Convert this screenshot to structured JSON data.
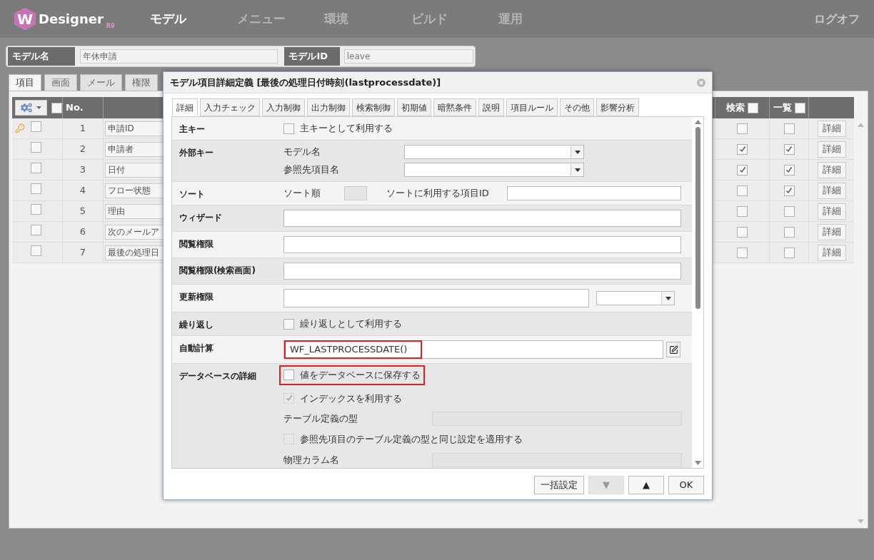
{
  "header": {
    "logo_letter": "W",
    "brand": "Designer",
    "version": "R9",
    "nav": [
      {
        "label": "モデル",
        "selected": true
      },
      {
        "label": "メニュー",
        "selected": false
      },
      {
        "label": "環境",
        "selected": false
      },
      {
        "label": "ビルド",
        "selected": false
      },
      {
        "label": "運用",
        "selected": false
      }
    ],
    "logoff": "ログオフ"
  },
  "model_bar": {
    "name_label": "モデル名",
    "name_value": "年休申請",
    "id_label": "モデルID",
    "id_value": "leave"
  },
  "tabs": [
    {
      "label": "項目",
      "selected": true
    },
    {
      "label": "画面",
      "selected": false
    },
    {
      "label": "メール",
      "selected": false
    },
    {
      "label": "権限",
      "selected": false
    }
  ],
  "table": {
    "columns": {
      "no": "No.",
      "search": "検索",
      "list": "一覧"
    },
    "select_all_checked": false,
    "search_all_checked": false,
    "list_all_checked": false,
    "rows": [
      {
        "primary_key": true,
        "checked": false,
        "no": "1",
        "name": "申請ID",
        "search": false,
        "list": false,
        "detail": "詳細"
      },
      {
        "primary_key": false,
        "checked": false,
        "no": "2",
        "name": "申請者",
        "search": true,
        "list": true,
        "detail": "詳細"
      },
      {
        "primary_key": false,
        "checked": false,
        "no": "3",
        "name": "日付",
        "search": true,
        "list": true,
        "detail": "詳細"
      },
      {
        "primary_key": false,
        "checked": false,
        "no": "4",
        "name": "フロー状態",
        "search": false,
        "list": true,
        "detail": "詳細"
      },
      {
        "primary_key": false,
        "checked": false,
        "no": "5",
        "name": "理由",
        "search": false,
        "list": false,
        "detail": "詳細"
      },
      {
        "primary_key": false,
        "checked": false,
        "no": "6",
        "name": "次のメールア",
        "search": false,
        "list": false,
        "detail": "詳細"
      },
      {
        "primary_key": false,
        "checked": false,
        "no": "7",
        "name": "最後の処理日",
        "search": false,
        "list": false,
        "detail": "詳細"
      }
    ]
  },
  "dialog": {
    "title": "モデル項目詳細定義 [最後の処理日付時刻(lastprocessdate)]",
    "tabs": [
      {
        "label": "詳細",
        "selected": true
      },
      {
        "label": "入力チェック",
        "selected": false
      },
      {
        "label": "入力制御",
        "selected": false
      },
      {
        "label": "出力制御",
        "selected": false
      },
      {
        "label": "検索制御",
        "selected": false
      },
      {
        "label": "初期値",
        "selected": false
      },
      {
        "label": "暗黙条件",
        "selected": false
      },
      {
        "label": "説明",
        "selected": false
      },
      {
        "label": "項目ルール",
        "selected": false
      },
      {
        "label": "その他",
        "selected": false
      },
      {
        "label": "影響分析",
        "selected": false
      }
    ],
    "rows": [
      {
        "kind": "checkbox",
        "label": "主キー",
        "option": {
          "label": "主キーとして利用する",
          "checked": false
        }
      },
      {
        "kind": "selects",
        "label": "外部キー",
        "fields": [
          {
            "label": "モデル名"
          },
          {
            "label": "参照先項目名"
          }
        ]
      },
      {
        "kind": "sort",
        "label": "ソート",
        "order_label": "ソート順",
        "id_label": "ソートに利用する項目ID"
      },
      {
        "kind": "text",
        "label": "ウィザード"
      },
      {
        "kind": "text",
        "label": "閲覧権限"
      },
      {
        "kind": "text",
        "label": "閲覧権限(検索画面)"
      },
      {
        "kind": "text_select",
        "label": "更新権限"
      },
      {
        "kind": "checkbox",
        "label": "繰り返し",
        "option": {
          "label": "繰り返しとして利用する",
          "checked": false
        }
      },
      {
        "kind": "formula",
        "label": "自動計算",
        "value": "WF_LASTPROCESSDATE()",
        "highlighted": true
      },
      {
        "kind": "database",
        "label": "データベースの詳細",
        "items": [
          {
            "kind": "checkbox",
            "label": "値をデータベースに保存する",
            "checked": false,
            "disabled": false,
            "highlighted": true
          },
          {
            "kind": "checkbox",
            "label": "インデックスを利用する",
            "checked": true,
            "disabled": true,
            "highlighted": false
          },
          {
            "kind": "field",
            "label": "テーブル定義の型",
            "disabled": true
          },
          {
            "kind": "checkbox",
            "label": "参照先項目のテーブル定義の型と同じ設定を適用する",
            "checked": false,
            "disabled": true,
            "highlighted": false
          },
          {
            "kind": "field",
            "label": "物理カラム名",
            "disabled": true
          }
        ]
      }
    ],
    "buttons": [
      {
        "label": "一括設定",
        "disabled": false
      },
      {
        "label": "▼",
        "disabled": true
      },
      {
        "label": "▲",
        "disabled": false
      },
      {
        "label": "OK",
        "disabled": false
      }
    ]
  }
}
